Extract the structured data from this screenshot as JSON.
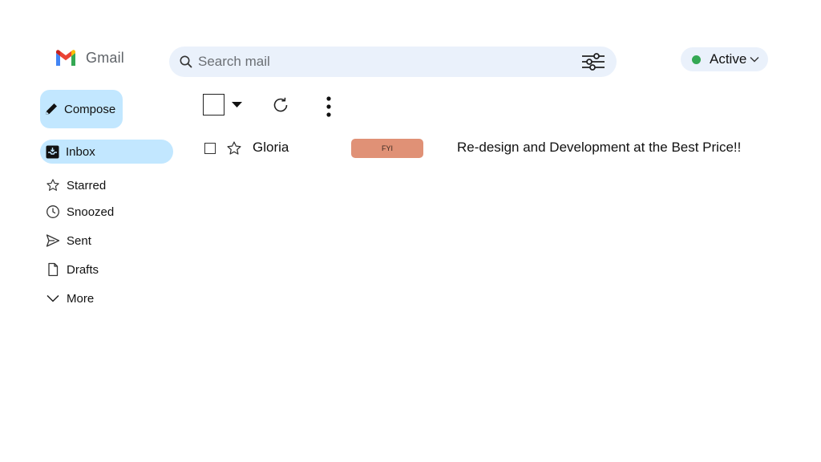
{
  "header": {
    "app_name": "Gmail",
    "search": {
      "placeholder": "Search mail"
    },
    "status": {
      "label": "Active",
      "color": "#34a853"
    }
  },
  "sidebar": {
    "compose_label": "Compose",
    "items": [
      {
        "label": "Inbox",
        "icon": "inbox-icon",
        "active": true
      },
      {
        "label": "Starred",
        "icon": "star-icon"
      },
      {
        "label": "Snoozed",
        "icon": "clock-icon"
      },
      {
        "label": "Sent",
        "icon": "send-icon"
      },
      {
        "label": "Drafts",
        "icon": "file-icon"
      },
      {
        "label": "More",
        "icon": "chevron-down-icon"
      }
    ]
  },
  "toolbar": {
    "icons": [
      "select-all-checkbox",
      "caret-down-icon",
      "refresh-icon",
      "more-vert-icon"
    ]
  },
  "emails": [
    {
      "sender": "Gloria",
      "tag": "FYI",
      "tag_color": "#e09176",
      "subject": "Re-design and Development at the Best Price!!"
    }
  ],
  "colors": {
    "accent": "#c2e7ff",
    "search_bg": "#eaf1fb"
  }
}
